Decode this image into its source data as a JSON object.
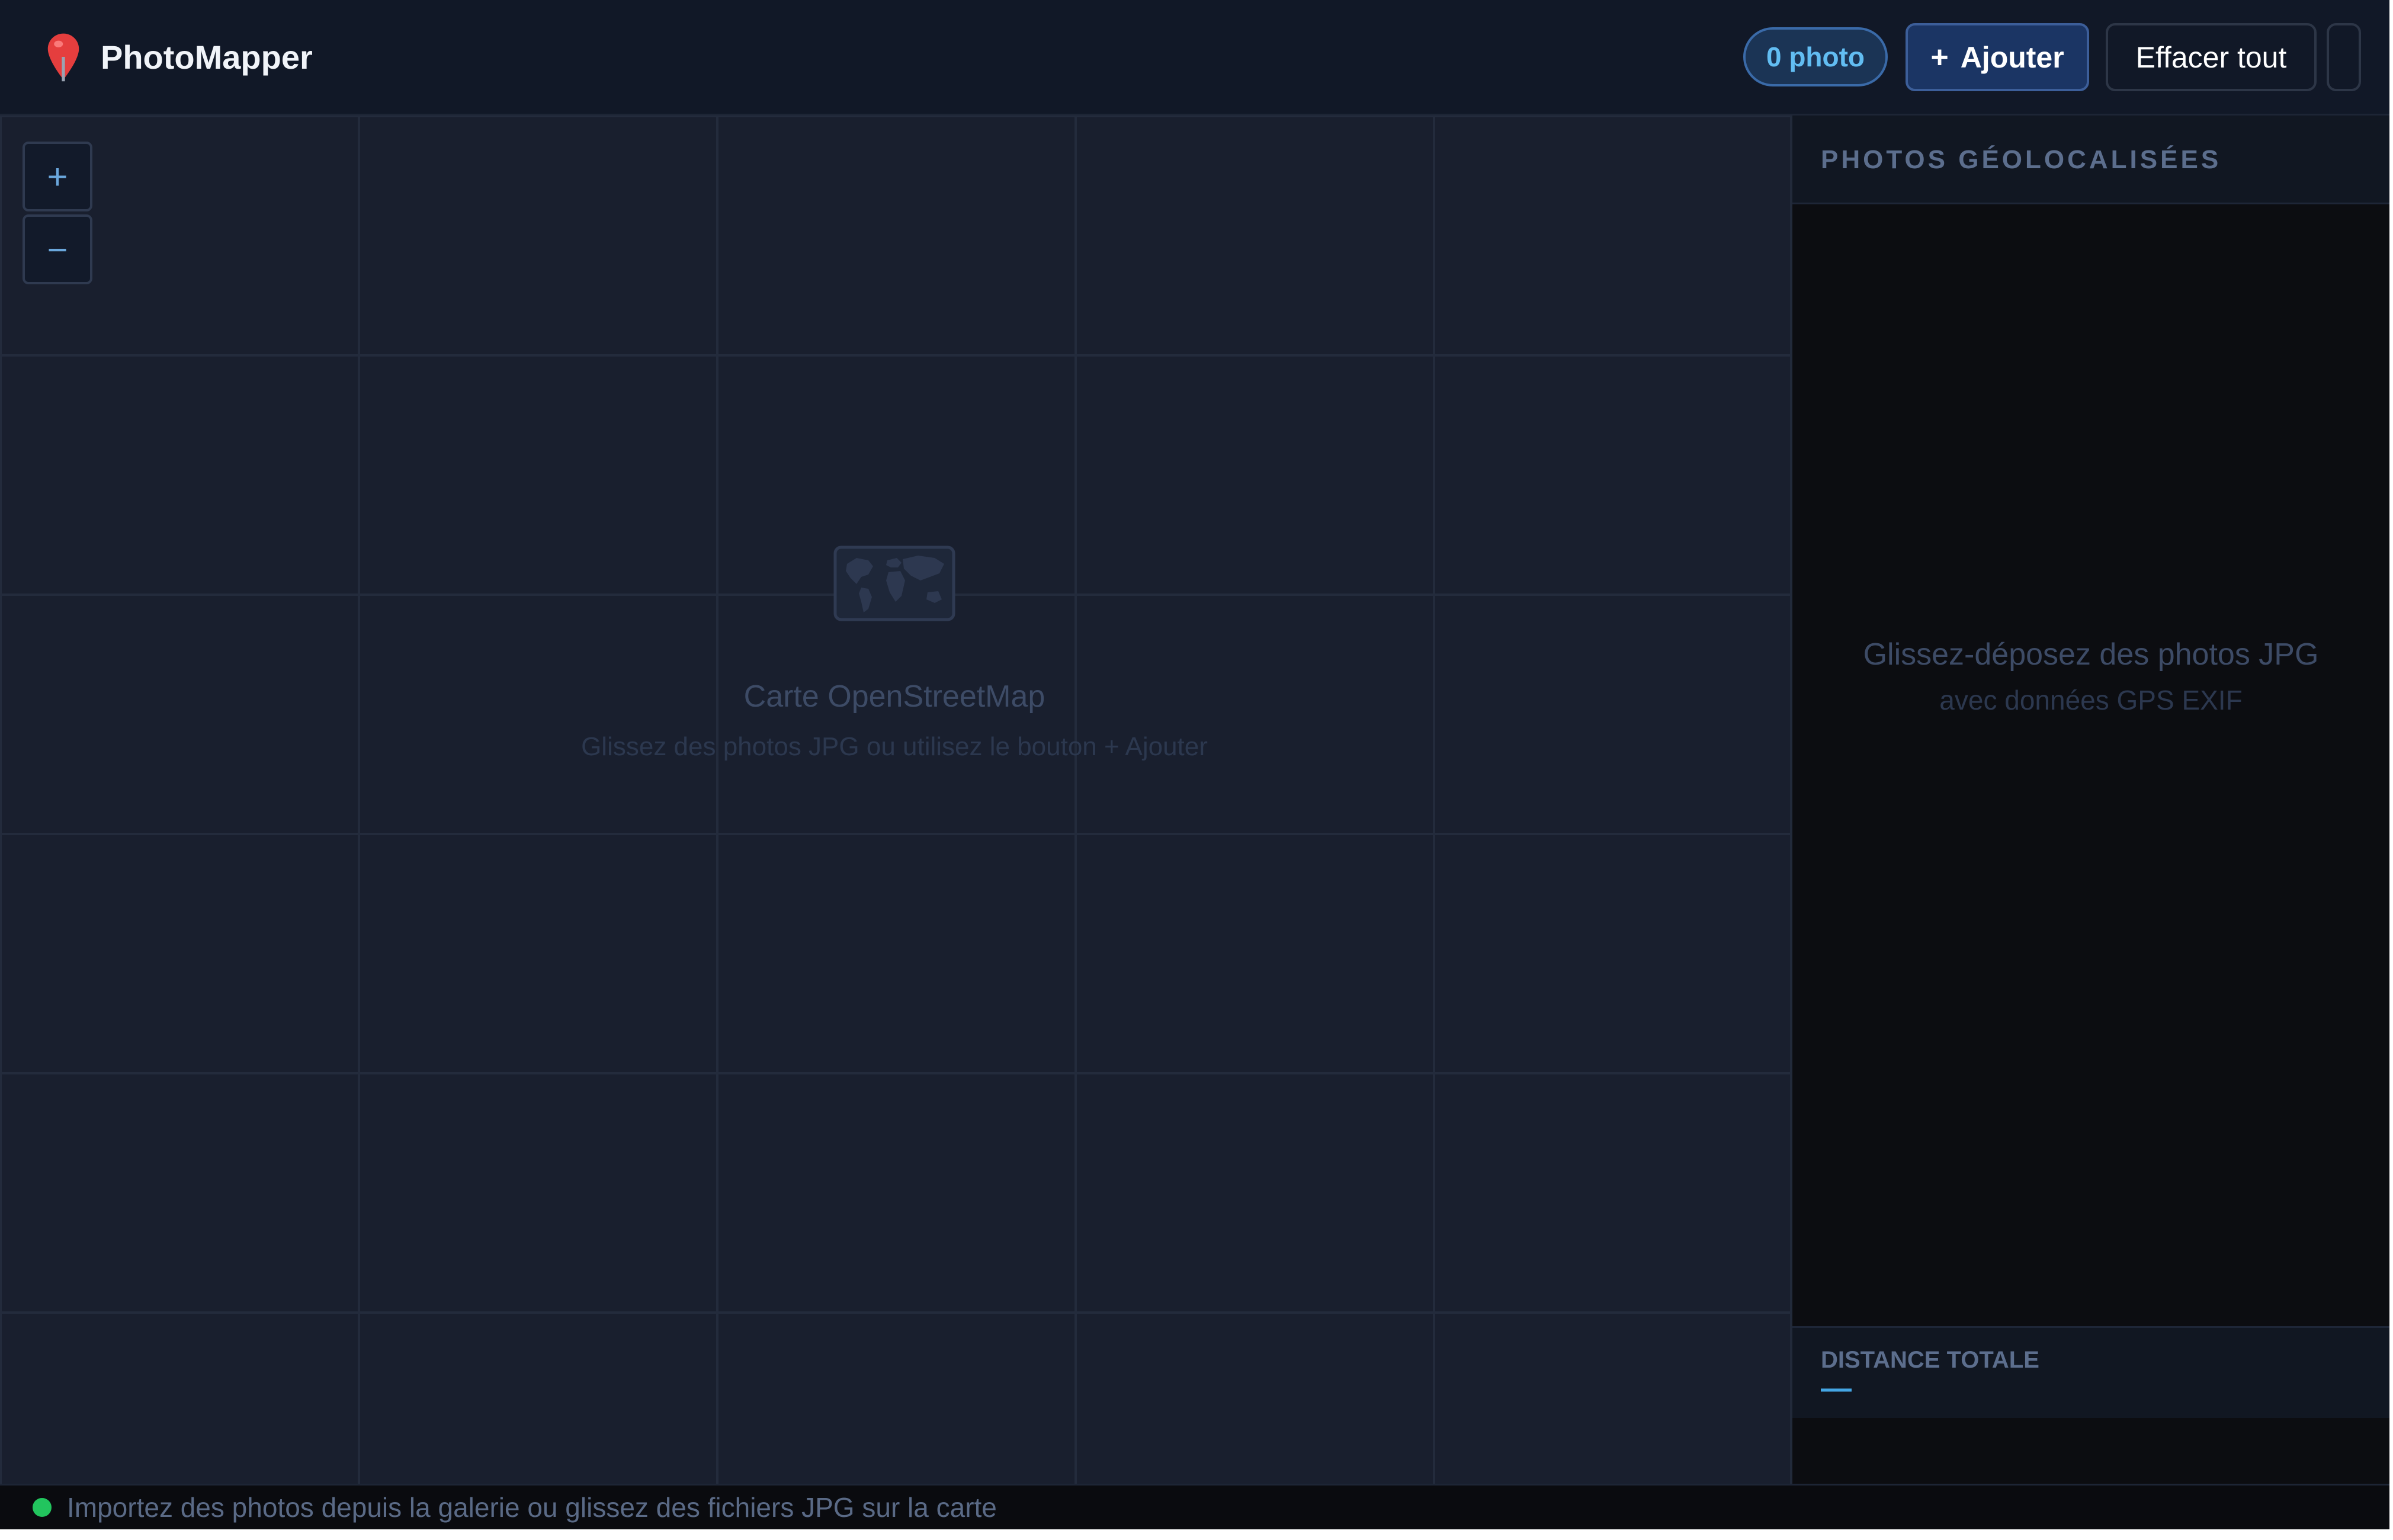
{
  "header": {
    "app_name": "PhotoMapper",
    "logo_icon": "map-pin-icon",
    "photo_count": "0 photo",
    "add_label": "Ajouter",
    "add_icon": "+",
    "clear_label": "Effacer tout"
  },
  "map": {
    "zoom_in": "+",
    "zoom_out": "−",
    "placeholder_icon": "world-map-icon",
    "title": "Carte OpenStreetMap",
    "subtitle": "Glissez des photos JPG ou utilisez le bouton + Ajouter"
  },
  "sidebar": {
    "title": "PHOTOS GÉOLOCALISÉES",
    "empty_line1": "Glissez-déposez des photos JPG",
    "empty_line2": "avec données GPS EXIF",
    "distance_title": "DISTANCE TOTALE",
    "distance_value": "—"
  },
  "status": {
    "text": "Importez des photos depuis la galerie ou glissez des fichiers JPG sur la carte",
    "indicator_color": "#22c55e"
  },
  "colors": {
    "accent": "#62bdf2",
    "pin": "#e53e3e",
    "map_background": "#191f2e",
    "sidebar_background": "#0c0d11"
  }
}
